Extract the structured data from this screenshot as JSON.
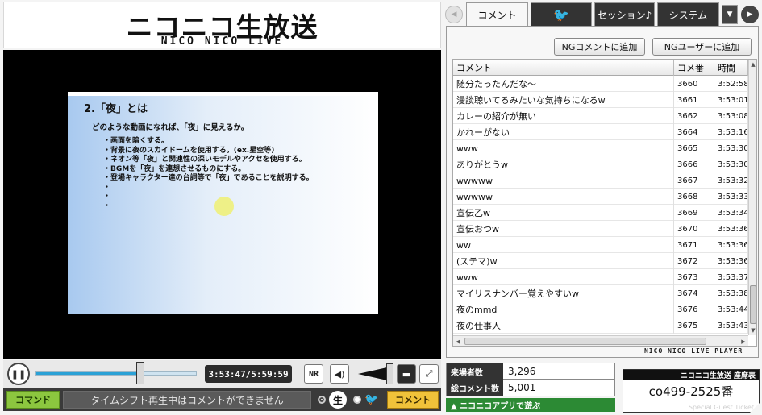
{
  "logo": {
    "main": "ニコニコ生放送",
    "sub": "NICO NICO LIVE"
  },
  "slide": {
    "title": "2.「夜」とは",
    "lead": "どのような動画になれば、「夜」に見えるか。",
    "bullets": [
      "画面を暗くする。",
      "背景に夜のスカイドームを使用する。(ex.星空等)",
      "ネオン等「夜」と関連性の深いモデルやアクセを使用する。",
      "BGMを「夜」を連想させるものにする。",
      "登場キャラクター達の台詞等で「夜」であることを説明する。",
      "",
      "",
      ""
    ]
  },
  "player": {
    "time": "3:53:47/5:59:59",
    "seek_progress": 0.655,
    "play_icon": "pause-icon",
    "nr_label": "NR",
    "command_label": "コマンド",
    "comment_input_placeholder": "タイムシフト再生中はコメントができません",
    "nama_label": "生",
    "comment_button": "コメント"
  },
  "tabs": {
    "comment": "コメント",
    "session": "セッション♪",
    "system": "システム"
  },
  "ng": {
    "comment_button": "NGコメントに追加",
    "user_button": "NGユーザーに追加"
  },
  "comments": {
    "headers": {
      "text": "コメント",
      "no": "コメ番",
      "time": "時間"
    },
    "rows": [
      {
        "text": "随分たったんだな～",
        "no": "3660",
        "time": "3:52:58"
      },
      {
        "text": "漫談聴いてるみたいな気持ちになるw",
        "no": "3661",
        "time": "3:53:01"
      },
      {
        "text": "カレーの紹介が無い",
        "no": "3662",
        "time": "3:53:08"
      },
      {
        "text": "かれーがない",
        "no": "3664",
        "time": "3:53:16"
      },
      {
        "text": "www",
        "no": "3665",
        "time": "3:53:30"
      },
      {
        "text": "ありがとうw",
        "no": "3666",
        "time": "3:53:30"
      },
      {
        "text": "wwwww",
        "no": "3667",
        "time": "3:53:32"
      },
      {
        "text": "wwwww",
        "no": "3668",
        "time": "3:53:33"
      },
      {
        "text": "宣伝乙w",
        "no": "3669",
        "time": "3:53:34"
      },
      {
        "text": "宣伝おつw",
        "no": "3670",
        "time": "3:53:36"
      },
      {
        "text": "ww",
        "no": "3671",
        "time": "3:53:36"
      },
      {
        "text": "(ステマ)w",
        "no": "3672",
        "time": "3:53:36"
      },
      {
        "text": "www",
        "no": "3673",
        "time": "3:53:37"
      },
      {
        "text": "マイリスナンバー覚えやすいw",
        "no": "3674",
        "time": "3:53:38"
      },
      {
        "text": "夜のmmd",
        "no": "3676",
        "time": "3:53:44"
      },
      {
        "text": "夜の仕事人",
        "no": "3675",
        "time": "3:53:43"
      }
    ]
  },
  "player_brand": "NICO NICO LIVE PLAYER",
  "stats": {
    "visitors_label": "来場者数",
    "visitors": "3,296",
    "comments_label": "総コメント数",
    "comments": "5,001"
  },
  "app_link": "▲ ニコニコアプリで遊ぶ",
  "ticket": {
    "header": "ニコニコ生放送 座席表",
    "seat": "co499-2525番",
    "footer": "Special Guest Ticket"
  },
  "colors": {
    "accent_green": "#8cc63f",
    "comment_yellow": "#f0c23a",
    "twitter_blue": "#37b6ea"
  }
}
